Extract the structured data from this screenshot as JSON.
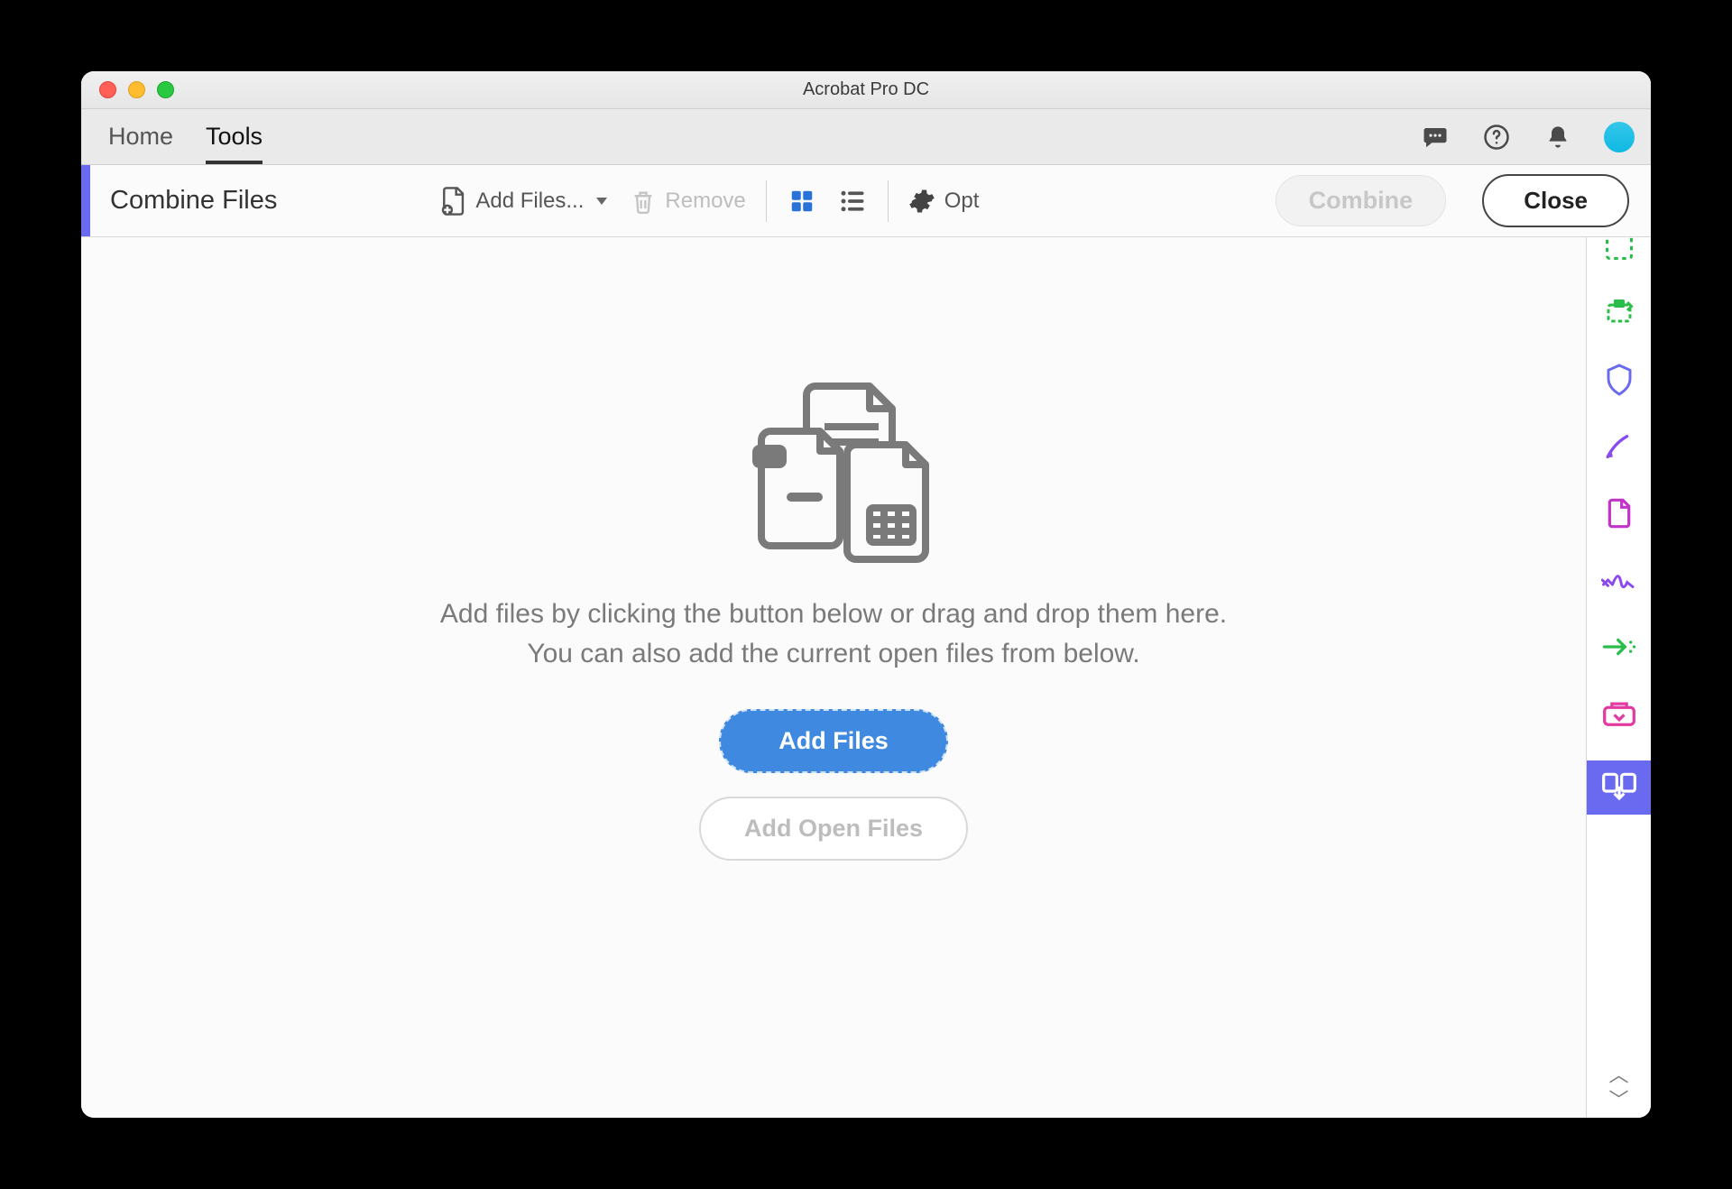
{
  "window": {
    "title": "Acrobat Pro DC"
  },
  "topnav": {
    "home": "Home",
    "tools": "Tools"
  },
  "toolbar": {
    "title": "Combine Files",
    "add_files": "Add Files...",
    "remove": "Remove",
    "options": "Opt",
    "combine": "Combine",
    "close": "Close"
  },
  "main": {
    "instruction_line1": "Add files by clicking the button below or drag and drop them here.",
    "instruction_line2": "You can also add the current open files from below.",
    "add_files_btn": "Add Files",
    "add_open_files_btn": "Add Open Files"
  },
  "right_rail": {
    "items": [
      {
        "name": "create-pdf-icon",
        "color": "#2bbd4a"
      },
      {
        "name": "export-pdf-icon",
        "color": "#2bbd4a"
      },
      {
        "name": "protect-icon",
        "color": "#6a6af0"
      },
      {
        "name": "edit-icon",
        "color": "#8a4af0"
      },
      {
        "name": "organize-icon",
        "color": "#c233c9"
      },
      {
        "name": "sign-icon",
        "color": "#8a4af0"
      },
      {
        "name": "send-icon",
        "color": "#2bbd4a"
      },
      {
        "name": "stamp-icon",
        "color": "#e23aa0"
      },
      {
        "name": "combine-icon",
        "color": "#ffffff",
        "active": true
      }
    ]
  }
}
